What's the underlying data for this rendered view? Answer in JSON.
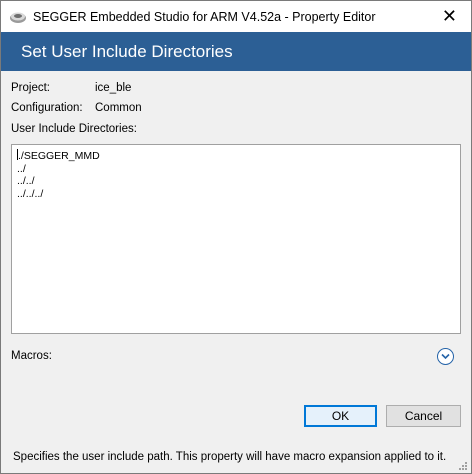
{
  "window": {
    "title": "SEGGER Embedded Studio for ARM V4.52a - Property Editor",
    "close_glyph": "✕"
  },
  "header": {
    "title": "Set User Include Directories"
  },
  "fields": {
    "project_label": "Project:",
    "project_value": "ice_ble",
    "configuration_label": "Configuration:",
    "configuration_value": "Common",
    "directories_label": "User Include Directories:"
  },
  "directories": {
    "lines": [
      "./SEGGER_MMD",
      "../",
      "../../",
      "../../../"
    ]
  },
  "macros": {
    "label": "Macros:",
    "icon": "chevron-down-icon"
  },
  "buttons": {
    "ok_label": "OK",
    "cancel_label": "Cancel"
  },
  "status": {
    "description": "Specifies the user include path. This property will have macro expansion applied to it."
  },
  "colors": {
    "header_bg": "#2c5f95",
    "header_text": "#ffffff",
    "accent": "#0078d7"
  }
}
